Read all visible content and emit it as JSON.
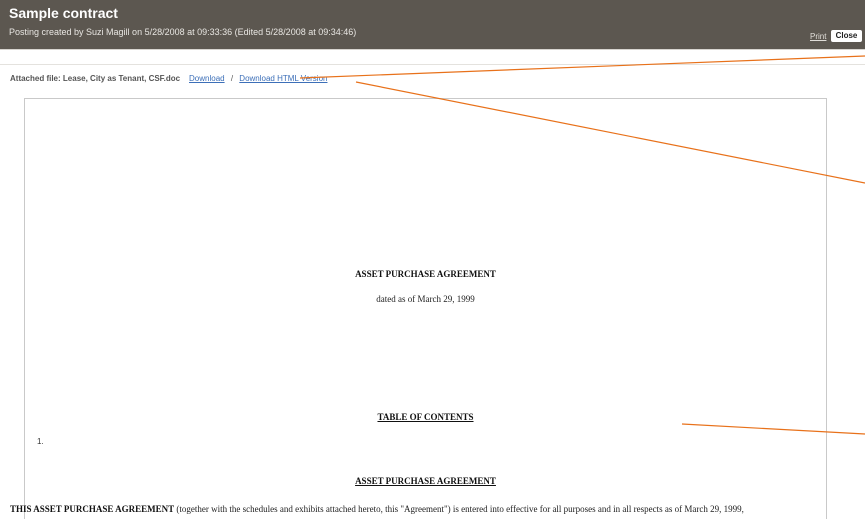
{
  "header": {
    "title": "Sample contract",
    "subtitle": "Posting created by Suzi Magill on 5/28/2008 at 09:33:36 (Edited 5/28/2008 at 09:34:46)",
    "print_label": "Print",
    "close_label": "Close",
    "bg_color": "#5c5750"
  },
  "attachment": {
    "label": "Attached file:",
    "filename": "Lease, City as Tenant, CSF.doc",
    "download_label": "Download",
    "separator": "/",
    "download_html_label": "Download HTML Version",
    "link_color": "#3c6fb8"
  },
  "document": {
    "title": "ASSET PURCHASE AGREEMENT",
    "date_line": "dated as of March 29, 1999",
    "toc_heading": "TABLE OF CONTENTS",
    "toc_item_number": "1.",
    "section_heading": "ASSET PURCHASE AGREEMENT",
    "para_bold": "THIS ASSET PURCHASE AGREEMENT",
    "para_rest": " (together with the schedules and exhibits attached hereto, this \"Agreement\") is entered into effective for all purposes and in all respects as of March 29, 1999,"
  },
  "callout_color": "#e8711a"
}
